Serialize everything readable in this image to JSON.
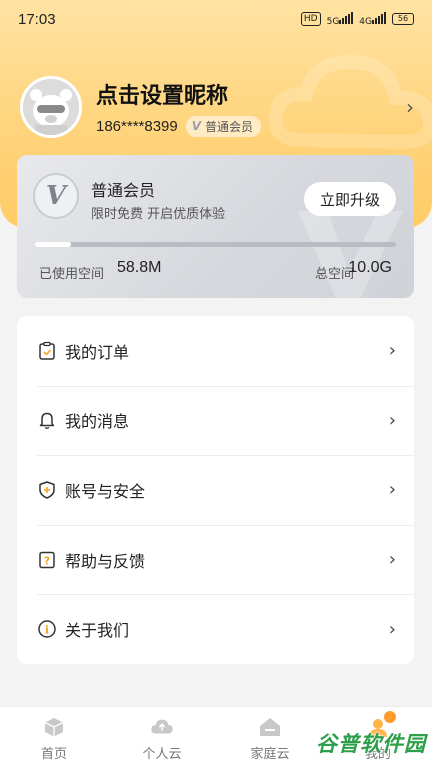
{
  "status_bar": {
    "time": "17:03",
    "icons": [
      "hd-icon",
      "signal-5g-icon",
      "signal-4g-icon",
      "battery-icon"
    ],
    "hd_label": "HD",
    "net1": "5G",
    "net2": "4G",
    "battery": "56"
  },
  "profile": {
    "nickname": "点击设置昵称",
    "phone": "186****8399",
    "badge_v": "V",
    "badge_label": "普通会员"
  },
  "member_card": {
    "logo": "V",
    "title": "普通会员",
    "subtitle": "限时免费 开启优质体验",
    "upgrade_label": "立即升级",
    "used_label": "已使用空间",
    "used_value": "58.8M",
    "total_label": "总空间",
    "total_value": "10.0G",
    "usage_fraction": 0.1
  },
  "menu": {
    "items": [
      {
        "label": "我的订单",
        "icon": "order-icon"
      },
      {
        "label": "我的消息",
        "icon": "bell-icon"
      },
      {
        "label": "账号与安全",
        "icon": "shield-icon"
      },
      {
        "label": "帮助与反馈",
        "icon": "help-icon"
      },
      {
        "label": "关于我们",
        "icon": "info-icon"
      }
    ]
  },
  "tabbar": {
    "tabs": [
      {
        "label": "首页",
        "icon": "home-box-icon"
      },
      {
        "label": "个人云",
        "icon": "cloud-upload-icon"
      },
      {
        "label": "家庭云",
        "icon": "family-cloud-icon"
      },
      {
        "label": "我的",
        "icon": "profile-icon"
      }
    ]
  },
  "watermark": "谷普软件园",
  "colors": {
    "header_yellow": "#ffd37a",
    "accent_orange": "#ff9a2e",
    "card_gray": "#d7d9de"
  }
}
